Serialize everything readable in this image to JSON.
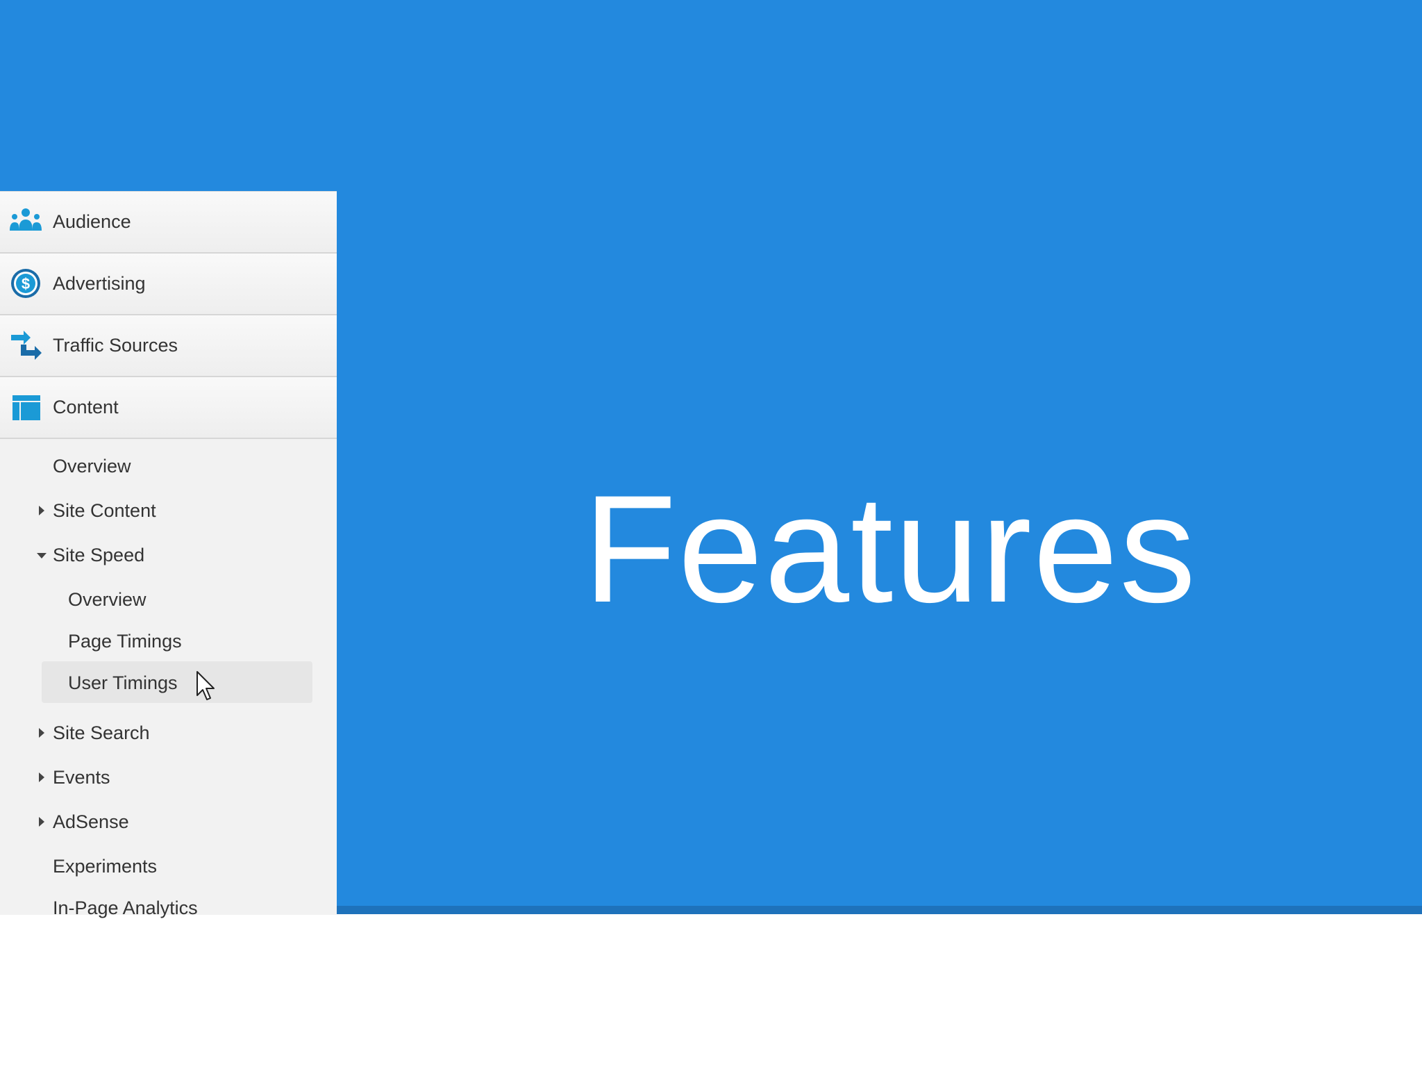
{
  "slide": {
    "title": "Features",
    "background_color": "#2389de"
  },
  "nav": {
    "sections": [
      {
        "label": "Audience",
        "icon": "audience-icon"
      },
      {
        "label": "Advertising",
        "icon": "dollar-icon"
      },
      {
        "label": "Traffic Sources",
        "icon": "traffic-arrows-icon"
      },
      {
        "label": "Content",
        "icon": "content-layout-icon"
      }
    ],
    "content_items": [
      {
        "label": "Overview"
      },
      {
        "label": "Site Content",
        "expand": "collapsed"
      },
      {
        "label": "Site Speed",
        "expand": "expanded"
      },
      {
        "label": "Overview",
        "level": 2
      },
      {
        "label": "Page Timings",
        "level": 2
      },
      {
        "label": "User Timings",
        "level": 2,
        "selected": true
      },
      {
        "label": "Site Search",
        "expand": "collapsed"
      },
      {
        "label": "Events",
        "expand": "collapsed"
      },
      {
        "label": "AdSense",
        "expand": "collapsed"
      },
      {
        "label": "Experiments"
      },
      {
        "label": "In-Page Analytics"
      }
    ]
  },
  "colors": {
    "icon_blue": "#1b9ad6",
    "icon_dark_blue": "#1a6ca8",
    "selected_bg": "#e6e6e6"
  }
}
